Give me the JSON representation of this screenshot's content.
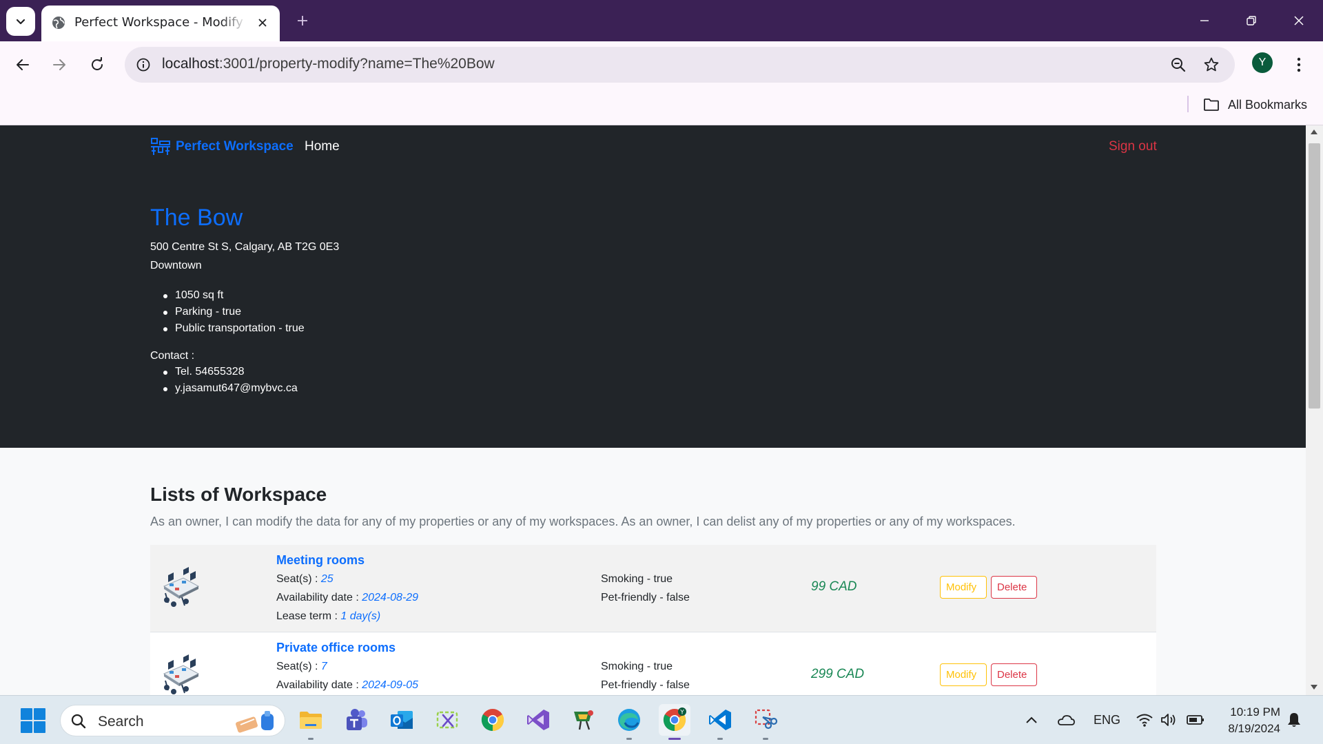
{
  "browser": {
    "tab_title": "Perfect Workspace - Modify property",
    "url_host": "localhost",
    "url_rest": ":3001/property-modify?name=The%20Bow",
    "profile_initial": "Y",
    "bookmarks_label": "All Bookmarks"
  },
  "navbar": {
    "brand": "Perfect Workspace",
    "home": "Home",
    "sign_out": "Sign out"
  },
  "property": {
    "name": "The Bow",
    "address": "500 Centre St S, Calgary, AB T2G 0E3",
    "neighborhood": "Downtown",
    "features": [
      "1050 sq ft",
      "Parking - true",
      "Public transportation - true"
    ],
    "contact_label": "Contact :",
    "contacts": [
      "Tel. 54655328",
      "y.jasamut647@mybvc.ca"
    ]
  },
  "section": {
    "title": "Lists of Workspace",
    "description": "As an owner, I can modify the data for any of my properties or any of my workspaces. As an owner, I can delist any of my properties or any of my workspaces."
  },
  "labels": {
    "seats": "Seat(s) : ",
    "availability": "Availability date : ",
    "lease": "Lease term : ",
    "modify": "Modify",
    "delete": "Delete"
  },
  "workspaces": [
    {
      "name": "Meeting rooms",
      "seats": "25",
      "availability": "2024-08-29",
      "lease": "1 day(s)",
      "smoking": "Smoking - true",
      "pet": "Pet-friendly - false",
      "price": "99 CAD"
    },
    {
      "name": "Private office rooms",
      "seats": "7",
      "availability": "2024-09-05",
      "smoking": "Smoking - true",
      "pet": "Pet-friendly - false",
      "price": "299 CAD"
    }
  ],
  "taskbar": {
    "search_label": "Search",
    "language": "ENG",
    "time": "10:19 PM",
    "date": "8/19/2024",
    "apps": [
      "file-explorer",
      "teams",
      "outlook",
      "snipping",
      "chrome",
      "visual-studio",
      "app",
      "edge",
      "chrome-profile",
      "vscode",
      "tool"
    ]
  },
  "colors": {
    "primary": "#0d6efd",
    "danger": "#dc3545",
    "warning": "#ffc107",
    "success": "#198754",
    "hero_bg": "#212529",
    "tabbar_bg": "#3b2155"
  }
}
